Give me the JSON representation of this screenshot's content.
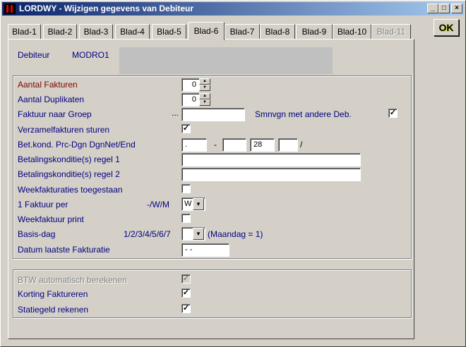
{
  "window": {
    "title": "LORDWY - Wijzigen gegevens van Debiteur",
    "minimize": "_",
    "maximize": "□",
    "close": "×"
  },
  "tabs": [
    "Blad-1",
    "Blad-2",
    "Blad-3",
    "Blad-4",
    "Blad-5",
    "Blad-6",
    "Blad-7",
    "Blad-8",
    "Blad-9",
    "Blad-10",
    "Blad-11"
  ],
  "ok_label": "OK",
  "debiteur": {
    "label": "Debiteur",
    "code": "MODRO1"
  },
  "form": {
    "aantal_fakturen": {
      "label": "Aantal Fakturen",
      "value": "0"
    },
    "aantal_duplikaten": {
      "label": "Aantal Duplikaten",
      "value": "0"
    },
    "faktuur_naar_groep": {
      "label": "Faktuur naar Groep",
      "ellipsis": "...",
      "value": ""
    },
    "smnvgn": {
      "label": "Smnvgn met andere Deb.",
      "checked": "✓"
    },
    "verzamelfakturen": {
      "label": "Verzamelfakturen sturen",
      "checked": "✓"
    },
    "betkond": {
      "label": "Bet.kond. Prc-Dgn DgnNet/End",
      "prc": ".",
      "dash": "-",
      "dgn": "",
      "net": "28",
      "end": "",
      "slash": "/"
    },
    "regel1": {
      "label": "Betalingskonditie(s) regel 1",
      "value": ""
    },
    "regel2": {
      "label": "Betalingskonditie(s) regel 2",
      "value": ""
    },
    "weekfakturaties": {
      "label": "Weekfakturaties toegestaan",
      "checked": ""
    },
    "faktuur_per": {
      "label": "1 Faktuur per",
      "hint": "-/W/M",
      "value": "W"
    },
    "weekfaktuur_print": {
      "label": "Weekfaktuur print",
      "checked": ""
    },
    "basis_dag": {
      "label": "Basis-dag",
      "hint": "1/2/3/4/5/6/7",
      "value": "",
      "note": "(Maandag  =  1)"
    },
    "datum_laatste": {
      "label": "Datum laatste Fakturatie",
      "value": " -  -"
    }
  },
  "lower": {
    "btw": {
      "label": "BTW automatisch berekenen",
      "checked": "✓"
    },
    "korting": {
      "label": "Korting    Faktureren",
      "checked": "✓"
    },
    "statiegeld": {
      "label": "Statiegeld rekenen",
      "checked": "✓"
    }
  },
  "glyphs": {
    "up": "▲",
    "down": "▼"
  }
}
